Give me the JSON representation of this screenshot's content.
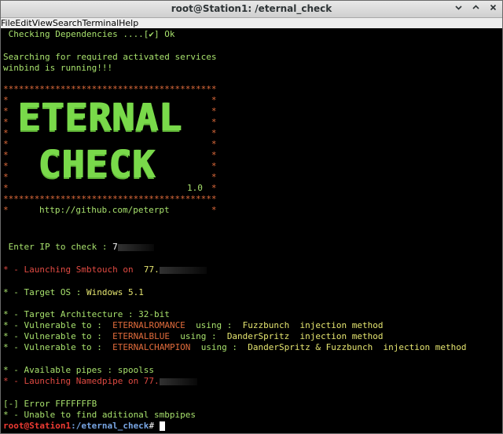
{
  "window": {
    "title": "root@Station1: /eternal_check",
    "minimize_icon": "chevron-down-icon",
    "maximize_icon": "chevron-up-icon",
    "close_icon": "close-icon"
  },
  "menu": [
    "File",
    "Edit",
    "View",
    "Search",
    "Terminal",
    "Help"
  ],
  "lines": {
    "deps": " Checking Dependencies ....[✔] Ok",
    "searching": "Searching for required activated services",
    "winbind": "winbind is running!!!",
    "logo_top": "ETERNAL",
    "logo_bottom": "CHECK",
    "version": "1.0",
    "url": "http://github.com/peterpt",
    "enter_ip_label": " Enter IP to check :",
    "enter_ip_value": "7",
    "launch_smb_prefix": "* - Launching Smbtouch on",
    "launch_smb_ip": "77.",
    "target_os_prefix": "* - Target OS :",
    "target_os_value": "Windows 5.1",
    "target_arch": "* - Target Architecture : 32-bit",
    "vulns": [
      {
        "prefix": "* - Vulnerable to :",
        "exploit": "ETERNALROMANCE",
        "using": "using :",
        "tool": "Fuzzbunch",
        "method": "injection method"
      },
      {
        "prefix": "* - Vulnerable to :",
        "exploit": "ETERNALBLUE",
        "using": "using :",
        "tool": "DanderSpritz",
        "method": "injection method"
      },
      {
        "prefix": "* - Vulnerable to :",
        "exploit": "ETERNALCHAMPION",
        "using": "using :",
        "tool": "DanderSpritz & Fuzzbunch",
        "method": "injection method"
      }
    ],
    "pipes": "* - Available pipes : spoolss",
    "launch_named": "* - Launching Namedpipe on 77.",
    "error": "[-] Error FFFFFFFB",
    "unable": "* - Unable to find aditional smbpipes",
    "prompt_user": "root@Station1",
    "prompt_path": ":/eternal_check",
    "prompt_sign": "# "
  },
  "colors": {
    "green": "#a7e06c",
    "red": "#e04a42",
    "yellow": "#e5e570",
    "orange": "#e06b3b",
    "path_blue": "#78a5e3"
  }
}
